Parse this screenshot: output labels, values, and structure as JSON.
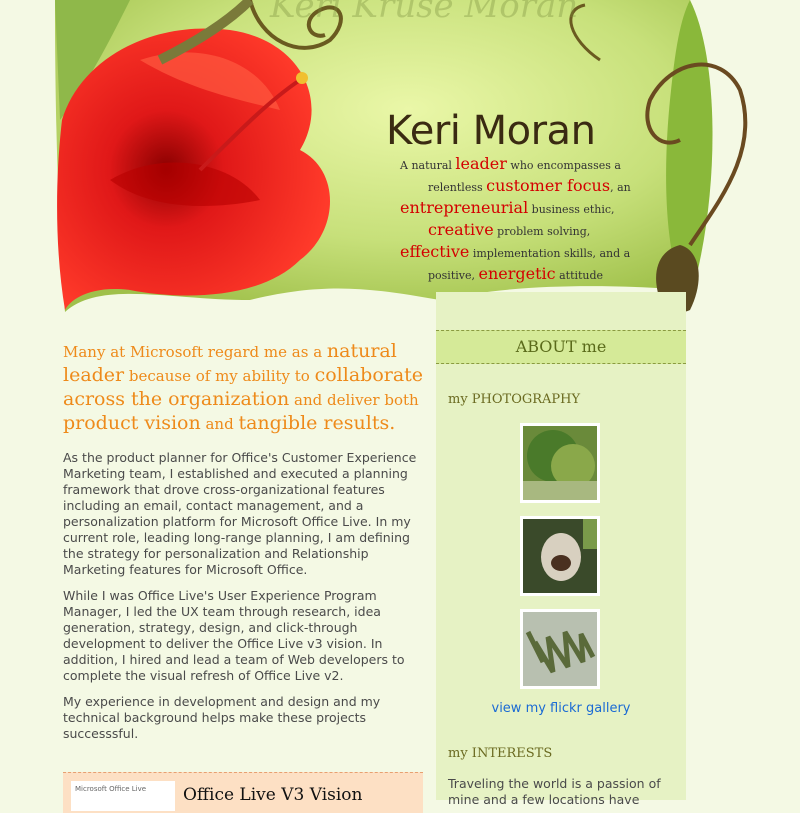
{
  "header": {
    "name": "Keri Moran",
    "watermark": "Keri Kruse Moran",
    "tagline": {
      "l1a": "A natural ",
      "l1h": "leader",
      "l1b": " who encompasses a",
      "l2a": "relentless ",
      "l2h": "customer focus",
      "l2b": ", an",
      "l3h": "entrepreneurial",
      "l3b": " business ethic,",
      "l4h": "creative",
      "l4b": " problem solving,",
      "l5h": "effective",
      "l5b": " implementation skills, and a",
      "l6a": "positive, ",
      "l6h": "energetic",
      "l6b": " attitude"
    }
  },
  "main": {
    "intro": {
      "p1": "Many at Microsoft regard me as a ",
      "h1": "natural leader",
      "p2": " because of my ability to ",
      "h2": "collaborate across the organization",
      "p3": " and deliver both ",
      "h3": "product vision",
      "p4": " and ",
      "h4": "tangible results."
    },
    "paragraphs": [
      "As the product planner for Office's Customer Experience Marketing team, I established and executed a planning framework that drove cross-organizational features including an email, contact management, and a personalization platform for Microsoft Office Live. In my current role, leading long-range planning, I am defining the strategy for personalization and Relationship Marketing features for Microsoft Office.",
      "While I was Office Live's User Experience Program Manager, I led the UX team through research, idea generation, strategy, design, and click-through development to deliver the Office Live v3 vision. In addition, I hired and lead a team of Web developers to complete the visual refresh of Office Live v2.",
      "My experience in development and design and my technical background helps make these projects successsful."
    ],
    "card": {
      "logo_text": "Microsoft Office Live",
      "title": "Office Live V3 Vision"
    }
  },
  "sidebar": {
    "about": "ABOUT me",
    "photography": "my PHOTOGRAPHY",
    "flickr_link": "view my flickr gallery",
    "interests_heading": "my INTERESTS",
    "interests_text": "Traveling the world is a passion of mine and a few locations have"
  },
  "colors": {
    "accent": "#ee8a1a",
    "highlight": "#d40000",
    "link": "#1a6ad4",
    "background": "#f4f9e4"
  }
}
